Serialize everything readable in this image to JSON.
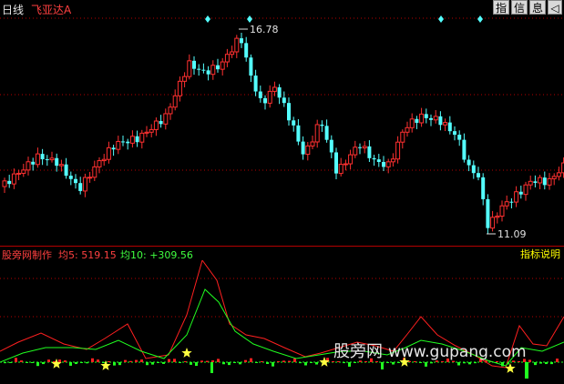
{
  "toolbar": {
    "period": "日线",
    "stock_name": "飞亚达A",
    "buttons": [
      "指",
      "信",
      "息",
      "◁"
    ]
  },
  "price_panel": {
    "high_label": "16.78",
    "low_label": "11.09",
    "colors": {
      "up": "#ff3030",
      "down": "#54ffff",
      "grid": "#b40000",
      "label": "#e0e0e0",
      "marker": "#54ffff"
    }
  },
  "indicator": {
    "name": "股旁网制作",
    "ma5_label": "均5: 519.15",
    "ma10_label": "均10: +309.56",
    "help": "指标说明",
    "colors": {
      "line_red": "#ff2020",
      "line_green": "#20ff20",
      "star": "#ffff40",
      "bar_red": "#ff2020",
      "bar_green": "#20ff20"
    }
  },
  "watermark": {
    "text": "股旁网",
    "url": "www.gupang.com"
  }
}
